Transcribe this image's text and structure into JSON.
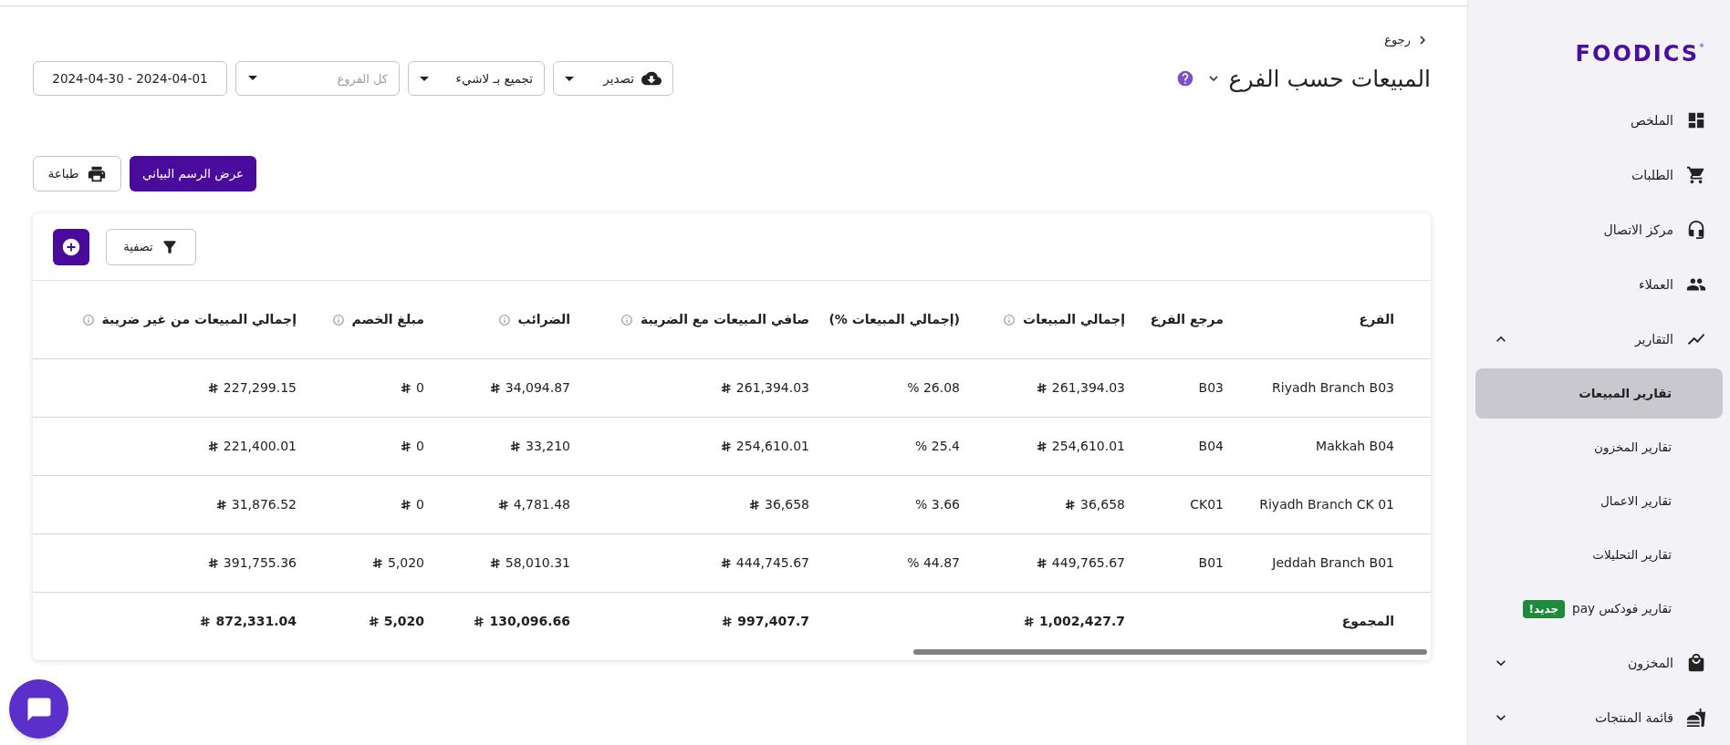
{
  "sidebar": {
    "logo": {
      "text": "FOODICS",
      "mark": "®"
    },
    "items": [
      {
        "kind": "dashboard",
        "label": "الملخص"
      },
      {
        "kind": "cart",
        "label": "الطلبات"
      },
      {
        "kind": "headset",
        "label": "مركز الاتصال"
      },
      {
        "kind": "people",
        "label": "العملاء"
      },
      {
        "kind": "chart",
        "label": "التقارير",
        "expanded": true,
        "children": [
          {
            "label": "تقارير المبيعات",
            "selected": true
          },
          {
            "label": "تقارير المخزون",
            "selected": false
          },
          {
            "label": "تقارير الاعمال",
            "selected": false
          },
          {
            "label": "تقارير التحليلات",
            "selected": false
          },
          {
            "label": "تقارير فودكس pay",
            "selected": false,
            "badge": "جديد!"
          }
        ]
      },
      {
        "kind": "bag",
        "label": "المخزون",
        "expanded": false
      },
      {
        "kind": "food",
        "label": "قائمة المنتجات",
        "expanded": false
      }
    ]
  },
  "header": {
    "back": "رجوع",
    "title": "المبيعات حسب الفرع",
    "export": "تصدير",
    "group_by": "تجميع بـ لاشيء",
    "branches": {
      "placeholder": "كل الفروع"
    },
    "date_range": "2024-04-30 - 2024-04-01",
    "chart_button": "عرض الرسم البياني",
    "print_button": "طباعة"
  },
  "table": {
    "filter": "تصفية",
    "columns": [
      {
        "label": "الفرع",
        "info": false
      },
      {
        "label": "مرجع الفرع",
        "info": false
      },
      {
        "label": "إجمالي المبيعات",
        "info": true
      },
      {
        "label": "(إجمالي المبيعات %)",
        "info": false
      },
      {
        "label": "صافي المبيعات مع الضريبة",
        "info": true
      },
      {
        "label": "الضرائب",
        "info": true
      },
      {
        "label": "مبلغ الخصم",
        "info": true
      },
      {
        "label": "إجمالي المبيعات من غير ضريبة",
        "info": true
      }
    ],
    "rows": [
      {
        "total": false,
        "cells": [
          {
            "text": "Riyadh Branch B03",
            "kind": "text"
          },
          {
            "text": "B03",
            "kind": "text"
          },
          {
            "text": "261,394.03",
            "kind": "money"
          },
          {
            "text": "% 26.08",
            "kind": "percent"
          },
          {
            "text": "261,394.03",
            "kind": "money"
          },
          {
            "text": "34,094.87",
            "kind": "money"
          },
          {
            "text": "0",
            "kind": "money"
          },
          {
            "text": "227,299.15",
            "kind": "money"
          }
        ]
      },
      {
        "total": false,
        "cells": [
          {
            "text": "Makkah B04",
            "kind": "text"
          },
          {
            "text": "B04",
            "kind": "text"
          },
          {
            "text": "254,610.01",
            "kind": "money"
          },
          {
            "text": "% 25.4",
            "kind": "percent"
          },
          {
            "text": "254,610.01",
            "kind": "money"
          },
          {
            "text": "33,210",
            "kind": "money"
          },
          {
            "text": "0",
            "kind": "money"
          },
          {
            "text": "221,400.01",
            "kind": "money"
          }
        ]
      },
      {
        "total": false,
        "cells": [
          {
            "text": "Riyadh Branch CK 01",
            "kind": "text"
          },
          {
            "text": "CK01",
            "kind": "text"
          },
          {
            "text": "36,658",
            "kind": "money"
          },
          {
            "text": "% 3.66",
            "kind": "percent"
          },
          {
            "text": "36,658",
            "kind": "money"
          },
          {
            "text": "4,781.48",
            "kind": "money"
          },
          {
            "text": "0",
            "kind": "money"
          },
          {
            "text": "31,876.52",
            "kind": "money"
          }
        ]
      },
      {
        "total": false,
        "cells": [
          {
            "text": "Jeddah Branch B01",
            "kind": "text"
          },
          {
            "text": "B01",
            "kind": "text"
          },
          {
            "text": "449,765.67",
            "kind": "money"
          },
          {
            "text": "% 44.87",
            "kind": "percent"
          },
          {
            "text": "444,745.67",
            "kind": "money"
          },
          {
            "text": "58,010.31",
            "kind": "money"
          },
          {
            "text": "5,020",
            "kind": "money"
          },
          {
            "text": "391,755.36",
            "kind": "money"
          }
        ]
      },
      {
        "total": true,
        "cells": [
          {
            "text": "المجموع",
            "kind": "text"
          },
          null,
          {
            "text": "1,002,427.7",
            "kind": "money"
          },
          null,
          {
            "text": "997,407.7",
            "kind": "money"
          },
          {
            "text": "130,096.66",
            "kind": "money"
          },
          {
            "text": "5,020",
            "kind": "money"
          },
          {
            "text": "872,331.04",
            "kind": "money"
          }
        ]
      }
    ]
  }
}
